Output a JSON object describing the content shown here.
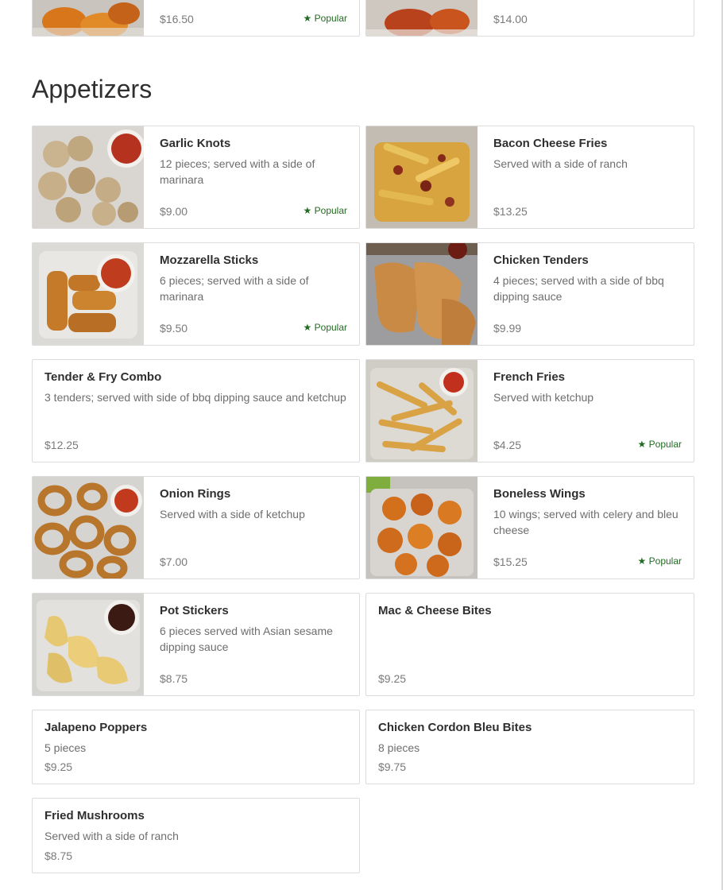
{
  "popular_label": "★ Popular",
  "colors": {
    "popular": "#226b22",
    "price": "#7a7a7a",
    "border": "#dcdcdc"
  },
  "top_partial": [
    {
      "price": "$16.50",
      "popular": true
    },
    {
      "price": "$14.00",
      "popular": false
    }
  ],
  "section": {
    "title": "Appetizers"
  },
  "items": [
    {
      "name": "Garlic Knots",
      "description": "12 pieces; served with a side of marinara",
      "price": "$9.00",
      "popular": true,
      "image": "garlic-knots-photo"
    },
    {
      "name": "Bacon Cheese Fries",
      "description": "Served with a side of ranch",
      "price": "$13.25",
      "popular": false,
      "image": "bacon-cheese-fries-photo"
    },
    {
      "name": "Mozzarella Sticks",
      "description": "6 pieces; served with a side of marinara",
      "price": "$9.50",
      "popular": true,
      "image": "mozzarella-sticks-photo"
    },
    {
      "name": "Chicken Tenders",
      "description": "4 pieces; served with a side of bbq dipping sauce",
      "price": "$9.99",
      "popular": false,
      "image": "chicken-tenders-photo"
    },
    {
      "name": "Tender & Fry Combo",
      "description": "3 tenders; served with side of bbq dipping sauce and ketchup",
      "price": "$12.25",
      "popular": false,
      "image": null
    },
    {
      "name": "French Fries",
      "description": "Served with ketchup",
      "price": "$4.25",
      "popular": true,
      "image": "french-fries-photo"
    },
    {
      "name": "Onion Rings",
      "description": "Served with a side of ketchup",
      "price": "$7.00",
      "popular": false,
      "image": "onion-rings-photo"
    },
    {
      "name": "Boneless Wings",
      "description": "10 wings; served with celery and bleu cheese",
      "price": "$15.25",
      "popular": true,
      "image": "boneless-wings-photo"
    },
    {
      "name": "Pot Stickers",
      "description": "6 pieces served with Asian sesame dipping sauce",
      "price": "$8.75",
      "popular": false,
      "image": "pot-stickers-photo"
    },
    {
      "name": "Mac & Cheese Bites",
      "description": "",
      "price": "$9.25",
      "popular": false,
      "image": null
    },
    {
      "name": "Jalapeno Poppers",
      "description": "5 pieces",
      "price": "$9.25",
      "popular": false,
      "image": null
    },
    {
      "name": "Chicken Cordon Bleu Bites",
      "description": "8 pieces",
      "price": "$9.75",
      "popular": false,
      "image": null
    },
    {
      "name": "Fried Mushrooms",
      "description": "Served with a side of ranch",
      "price": "$8.75",
      "popular": false,
      "image": null
    }
  ]
}
